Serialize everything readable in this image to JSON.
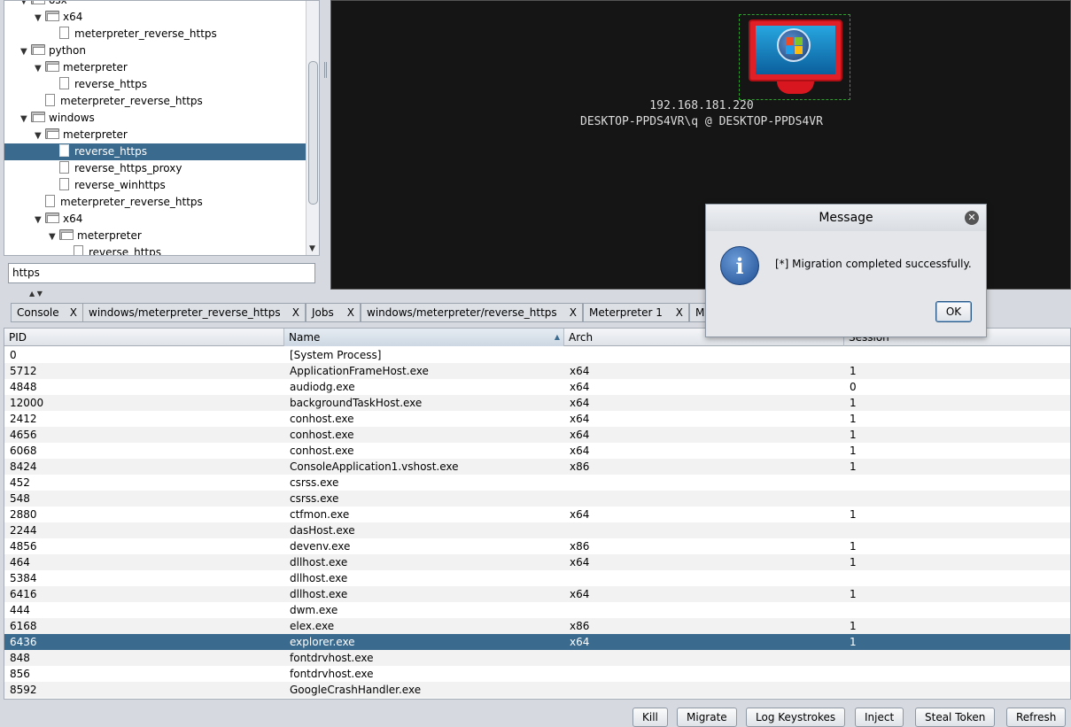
{
  "tree": {
    "items": [
      {
        "label": "osx",
        "type": "folder",
        "expanded": true,
        "level": 0,
        "selected": false
      },
      {
        "label": "x64",
        "type": "folder",
        "expanded": true,
        "level": 1,
        "selected": false
      },
      {
        "label": "meterpreter_reverse_https",
        "type": "file",
        "level": 2,
        "selected": false
      },
      {
        "label": "python",
        "type": "folder",
        "expanded": true,
        "level": 0,
        "selected": false
      },
      {
        "label": "meterpreter",
        "type": "folder",
        "expanded": true,
        "level": 1,
        "selected": false
      },
      {
        "label": "reverse_https",
        "type": "file",
        "level": 2,
        "selected": false
      },
      {
        "label": "meterpreter_reverse_https",
        "type": "file",
        "level": 1,
        "selected": false
      },
      {
        "label": "windows",
        "type": "folder",
        "expanded": true,
        "level": 0,
        "selected": false
      },
      {
        "label": "meterpreter",
        "type": "folder",
        "expanded": true,
        "level": 1,
        "selected": false
      },
      {
        "label": "reverse_https",
        "type": "file",
        "level": 2,
        "selected": true
      },
      {
        "label": "reverse_https_proxy",
        "type": "file",
        "level": 2,
        "selected": false
      },
      {
        "label": "reverse_winhttps",
        "type": "file",
        "level": 2,
        "selected": false
      },
      {
        "label": "meterpreter_reverse_https",
        "type": "file",
        "level": 1,
        "selected": false
      },
      {
        "label": "x64",
        "type": "folder",
        "expanded": true,
        "level": 1,
        "selected": false
      },
      {
        "label": "meterpreter",
        "type": "folder",
        "expanded": true,
        "level": 2,
        "selected": false
      },
      {
        "label": "reverse_https",
        "type": "file",
        "level": 3,
        "selected": false
      }
    ]
  },
  "search": {
    "value": "https"
  },
  "graph": {
    "host_ip": "192.168.181.220",
    "host_user": "DESKTOP-PPDS4VR\\q @ DESKTOP-PPDS4VR",
    "host_icon": "windows-monitor-icon"
  },
  "tabs": [
    {
      "label": "Console",
      "close": "X"
    },
    {
      "label": "windows/meterpreter_reverse_https",
      "close": "X"
    },
    {
      "label": "Jobs",
      "close": "X"
    },
    {
      "label": "windows/meterpreter/reverse_https",
      "close": "X"
    },
    {
      "label": "Meterpreter 1",
      "close": "X"
    },
    {
      "label": "Me",
      "close": ""
    }
  ],
  "process_table": {
    "columns": [
      "PID",
      "Name",
      "Arch",
      "Session"
    ],
    "sorted_column": "Name",
    "rows": [
      {
        "pid": "0",
        "name": "[System Process]",
        "arch": "",
        "session": ""
      },
      {
        "pid": "5712",
        "name": "ApplicationFrameHost.exe",
        "arch": "x64",
        "session": "1"
      },
      {
        "pid": "4848",
        "name": "audiodg.exe",
        "arch": "x64",
        "session": "0"
      },
      {
        "pid": "12000",
        "name": "backgroundTaskHost.exe",
        "arch": "x64",
        "session": "1"
      },
      {
        "pid": "2412",
        "name": "conhost.exe",
        "arch": "x64",
        "session": "1"
      },
      {
        "pid": "4656",
        "name": "conhost.exe",
        "arch": "x64",
        "session": "1"
      },
      {
        "pid": "6068",
        "name": "conhost.exe",
        "arch": "x64",
        "session": "1"
      },
      {
        "pid": "8424",
        "name": "ConsoleApplication1.vshost.exe",
        "arch": "x86",
        "session": "1"
      },
      {
        "pid": "452",
        "name": "csrss.exe",
        "arch": "",
        "session": ""
      },
      {
        "pid": "548",
        "name": "csrss.exe",
        "arch": "",
        "session": ""
      },
      {
        "pid": "2880",
        "name": "ctfmon.exe",
        "arch": "x64",
        "session": "1"
      },
      {
        "pid": "2244",
        "name": "dasHost.exe",
        "arch": "",
        "session": ""
      },
      {
        "pid": "4856",
        "name": "devenv.exe",
        "arch": "x86",
        "session": "1"
      },
      {
        "pid": "464",
        "name": "dllhost.exe",
        "arch": "x64",
        "session": "1"
      },
      {
        "pid": "5384",
        "name": "dllhost.exe",
        "arch": "",
        "session": ""
      },
      {
        "pid": "6416",
        "name": "dllhost.exe",
        "arch": "x64",
        "session": "1"
      },
      {
        "pid": "444",
        "name": "dwm.exe",
        "arch": "",
        "session": ""
      },
      {
        "pid": "6168",
        "name": "elex.exe",
        "arch": "x86",
        "session": "1"
      },
      {
        "pid": "6436",
        "name": "explorer.exe",
        "arch": "x64",
        "session": "1",
        "selected": true
      },
      {
        "pid": "848",
        "name": "fontdrvhost.exe",
        "arch": "",
        "session": ""
      },
      {
        "pid": "856",
        "name": "fontdrvhost.exe",
        "arch": "",
        "session": ""
      },
      {
        "pid": "8592",
        "name": "GoogleCrashHandler.exe",
        "arch": "",
        "session": ""
      }
    ]
  },
  "actions": {
    "kill": "Kill",
    "migrate": "Migrate",
    "log_keystrokes": "Log Keystrokes",
    "inject": "Inject",
    "steal_token": "Steal Token",
    "refresh": "Refresh"
  },
  "dialog": {
    "title": "Message",
    "message": "[*] Migration completed successfully.",
    "ok": "OK",
    "icon": "info-icon"
  },
  "colors": {
    "selection": "#3a6a8e",
    "graph_background": "#151515"
  }
}
